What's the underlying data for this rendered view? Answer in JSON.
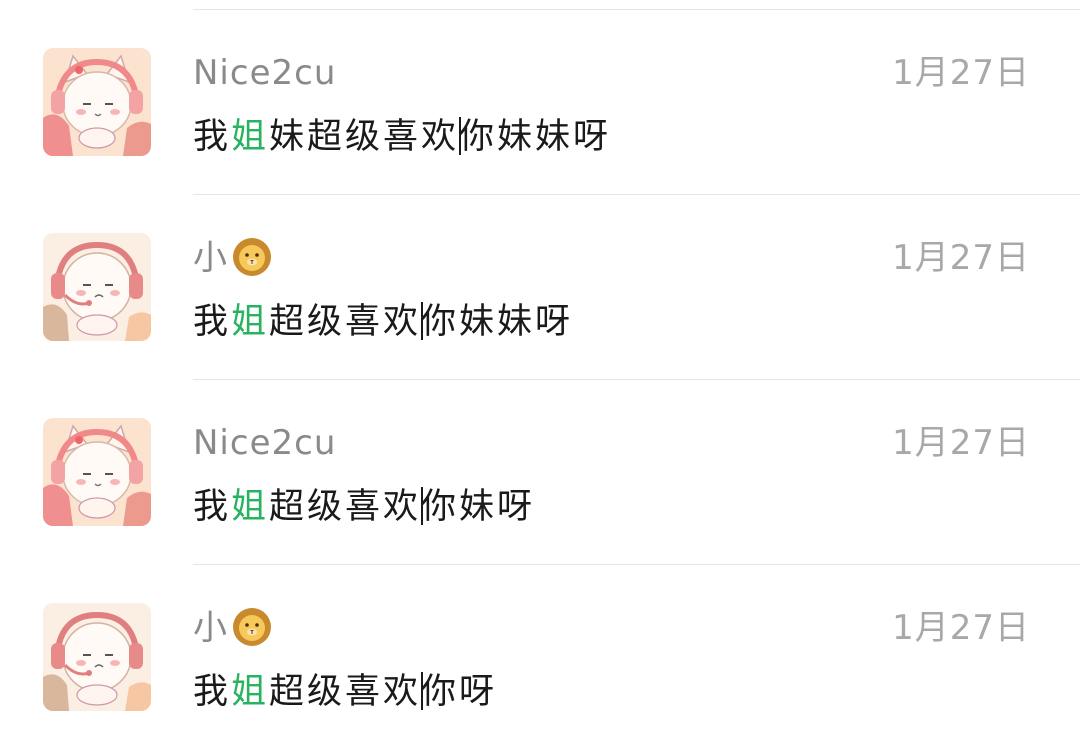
{
  "messages": [
    {
      "sender": "Nice2cu",
      "sender_emoji": "",
      "avatar": "cat-girl-headphones-avatar",
      "date": "1月27日",
      "text_before": "我",
      "highlight": "姐",
      "text_middle": "妹超级喜欢",
      "text_after": "你妹妹呀"
    },
    {
      "sender": "小",
      "sender_emoji": "lion-face-emoji",
      "avatar": "boy-headphones-avatar",
      "date": "1月27日",
      "text_before": "我",
      "highlight": "姐",
      "text_middle": "超级喜欢",
      "text_after": "你妹妹呀"
    },
    {
      "sender": "Nice2cu",
      "sender_emoji": "",
      "avatar": "cat-girl-headphones-avatar",
      "date": "1月27日",
      "text_before": "我",
      "highlight": "姐",
      "text_middle": "超级喜欢",
      "text_after": "你妹呀"
    },
    {
      "sender": "小",
      "sender_emoji": "lion-face-emoji",
      "avatar": "boy-headphones-avatar",
      "date": "1月27日",
      "text_before": "我",
      "highlight": "姐",
      "text_middle": "超级喜欢",
      "text_after": "你呀"
    }
  ],
  "colors": {
    "highlight": "#27b35f",
    "name": "#8a8a8a",
    "date": "#a8a8a8",
    "divider": "#e6e6e6"
  }
}
